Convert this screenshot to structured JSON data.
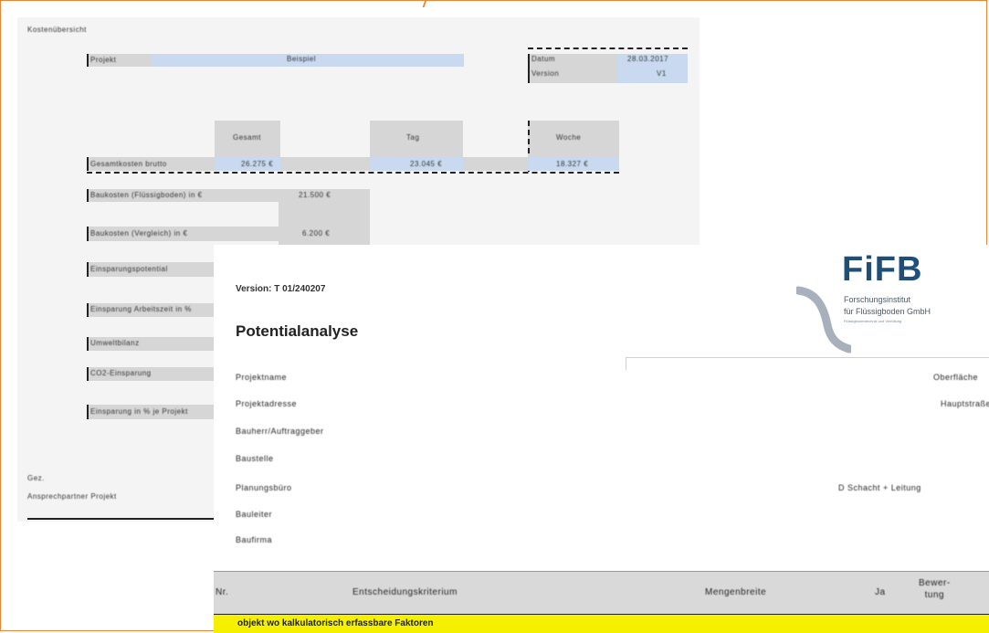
{
  "sheet1": {
    "heading": "Kostenübersicht",
    "projekt_label": "Projekt",
    "projekt_value": "Beispiel",
    "datum_label": "Datum",
    "datum_value": "28.03.2017",
    "version_label": "Version",
    "version_value": "V1",
    "col_a": "Gesamt",
    "col_b": "Tag",
    "col_c": "Woche",
    "row_total_label": "Gesamtkosten brutto",
    "row_total_a": "26.275 €",
    "row_total_b": "23.045 €",
    "row_total_c": "18.327 €",
    "row1_label": "Baukosten (Flüssigboden) in €",
    "row1_value": "21.500 €",
    "row2_label": "Baukosten (Vergleich) in €",
    "row2_value": "6.200 €",
    "row3_label": "Einsparungspotential",
    "row4_label": "Einsparung Arbeitszeit in %",
    "row5_label": "Umweltbilanz",
    "row6_label": "CO2-Einsparung",
    "row7_label": "Einsparung in % je Projekt",
    "footer1": "Gez.",
    "footer2": "Ansprechpartner Projekt"
  },
  "sheet2": {
    "version": "Version: T 01/240207",
    "title": "Potentialanalyse",
    "logo_text": "FiFB",
    "logo_sub1": "Forschungsinstitut",
    "logo_sub2": "für Flüssigboden GmbH",
    "logo_sub3": "Flüssigbodentechnik und Verfüllung",
    "fields": [
      "Projektname",
      "Projektadresse",
      "Bauherr/Auftraggeber",
      "Baustelle",
      "Planungsbüro",
      "Bauleiter",
      "Baufirma"
    ],
    "right1": "Oberfläche",
    "right2": "Hauptstraße",
    "right3": "D Schacht + Leitung",
    "table_header": {
      "col_nr": "Nr.",
      "col_criteria": "Entscheidungskriterium",
      "col_measure": "Mengenbreite",
      "col_ja": "Ja",
      "col_rating": "Bewer-\ntung"
    },
    "yellow_row": "objekt wo kalkulatorisch erfassbare Faktoren"
  },
  "colors": {
    "frame": "#e6873a",
    "cell_blue": "#c9daf0",
    "cell_gray": "#d6d6d6",
    "highlight_yellow": "#f4f000",
    "logo_blue": "#1f4e79"
  }
}
